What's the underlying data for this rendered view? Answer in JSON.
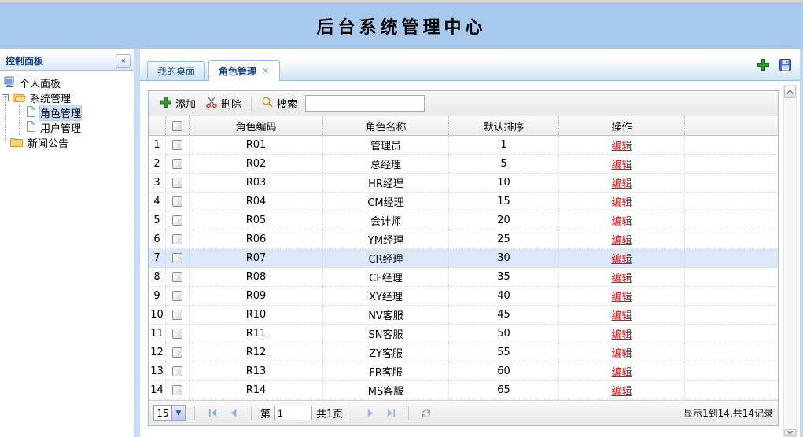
{
  "banner": {
    "title": "后台系统管理中心"
  },
  "sidebar": {
    "header": "控制面板",
    "collapse_label": "«",
    "items": [
      {
        "label": "个人面板",
        "icon": "computer-icon"
      },
      {
        "label": "系统管理",
        "icon": "folder-open-icon",
        "expander": "-"
      },
      {
        "label": "角色管理",
        "icon": "document-icon",
        "selected": true
      },
      {
        "label": "用户管理",
        "icon": "document-icon"
      },
      {
        "label": "新闻公告",
        "icon": "folder-icon"
      }
    ]
  },
  "tabs": {
    "desktop": "我的桌面",
    "role": "角色管理",
    "close": "×"
  },
  "header_icons": {
    "add": "add-icon",
    "save": "save-icon"
  },
  "toolbar": {
    "add": "添加",
    "delete": "删除",
    "search": "搜索",
    "search_value": ""
  },
  "grid": {
    "columns": {
      "code": "角色编码",
      "name": "角色名称",
      "sort": "默认排序",
      "op": "操作"
    },
    "edit": "编辑",
    "rows": [
      {
        "num": "1",
        "code": "R01",
        "name": "管理员",
        "sort": "1"
      },
      {
        "num": "2",
        "code": "R02",
        "name": "总经理",
        "sort": "5"
      },
      {
        "num": "3",
        "code": "R03",
        "name": "HR经理",
        "sort": "10"
      },
      {
        "num": "4",
        "code": "R04",
        "name": "CM经理",
        "sort": "15"
      },
      {
        "num": "5",
        "code": "R05",
        "name": "会计师",
        "sort": "20"
      },
      {
        "num": "6",
        "code": "R06",
        "name": "YM经理",
        "sort": "25"
      },
      {
        "num": "7",
        "code": "R07",
        "name": "CR经理",
        "sort": "30",
        "highlight": true
      },
      {
        "num": "8",
        "code": "R08",
        "name": "CF经理",
        "sort": "35"
      },
      {
        "num": "9",
        "code": "R09",
        "name": "XY经理",
        "sort": "40"
      },
      {
        "num": "10",
        "code": "R10",
        "name": "NV客服",
        "sort": "45"
      },
      {
        "num": "11",
        "code": "R11",
        "name": "SN客服",
        "sort": "50"
      },
      {
        "num": "12",
        "code": "R12",
        "name": "ZY客服",
        "sort": "55"
      },
      {
        "num": "13",
        "code": "R13",
        "name": "FR客服",
        "sort": "60"
      },
      {
        "num": "14",
        "code": "R14",
        "name": "MS客服",
        "sort": "65"
      }
    ]
  },
  "pagination": {
    "page_size": "15",
    "page_prefix": "第",
    "page_value": "1",
    "page_suffix": "共1页",
    "summary": "显示1到14,共14记录"
  },
  "colors": {
    "accent_border": "#99bbe8",
    "banner_bg": "#a8c9ee",
    "edit_link": "#ff0000",
    "highlight_row": "#dbe8fa",
    "tab_text": "#15428b"
  }
}
